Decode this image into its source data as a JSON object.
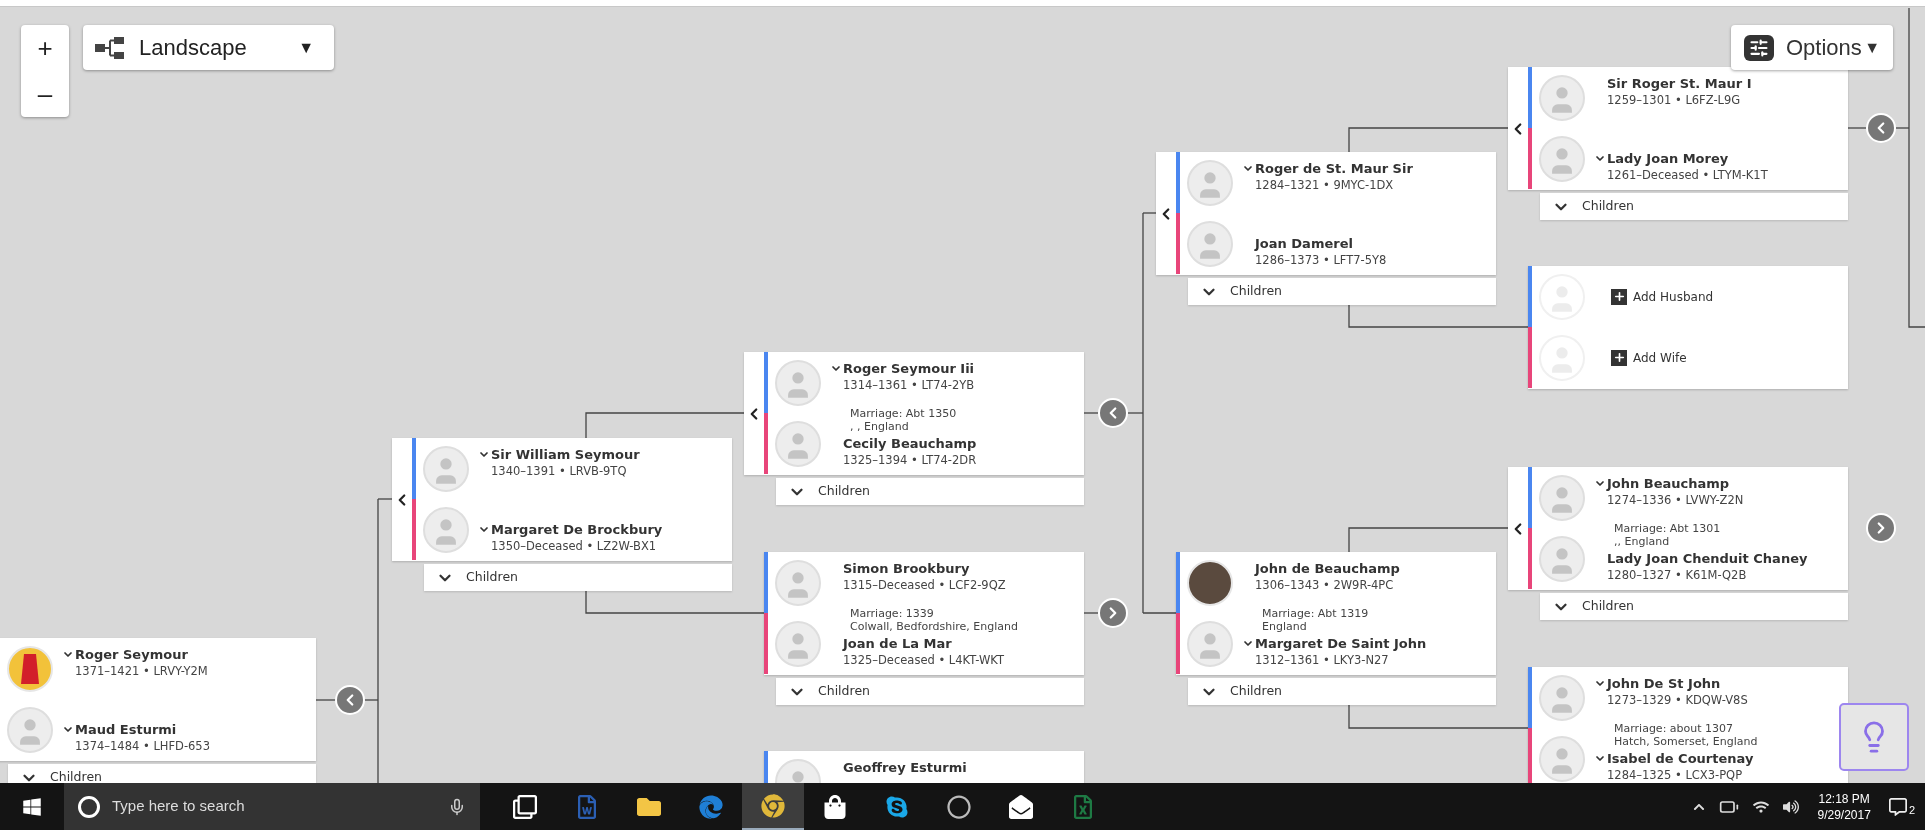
{
  "toolbar": {
    "zoom_in": "+",
    "zoom_out": "–",
    "view": {
      "label": "Landscape",
      "caret": "▼"
    },
    "options": {
      "label": "Options",
      "caret": "▼"
    }
  },
  "families": [
    {
      "parents_toggle": false,
      "husband": {
        "kind": "person",
        "name": "Roger Seymour",
        "vitals": "1371–1421 • LRVY-Y2M",
        "avatar": {
          "kind": "crest"
        },
        "expandable": true
      },
      "wife": {
        "kind": "person",
        "name": "Maud Esturmi",
        "vitals": "1374–1484 • LHFD-653",
        "avatar": {
          "kind": "silhouette"
        },
        "expandable": true
      },
      "children": "Children"
    },
    {
      "parents_toggle": true,
      "husband": {
        "kind": "person",
        "name": "Sir William Seymour",
        "vitals": "1340–1391 • LRVB-9TQ",
        "avatar": {
          "kind": "silhouette"
        },
        "expandable": true
      },
      "wife": {
        "kind": "person",
        "name": "Margaret De Brockbury",
        "vitals": "1350–Deceased • LZ2W-BX1",
        "avatar": {
          "kind": "silhouette"
        },
        "expandable": true
      },
      "children": "Children"
    },
    {
      "parents_toggle": true,
      "husband": {
        "kind": "person",
        "name": "Roger Seymour Iii",
        "vitals": "1314–1361 • LT74-2YB",
        "avatar": {
          "kind": "silhouette"
        },
        "expandable": true
      },
      "wife": {
        "kind": "person",
        "name": "Cecily Beauchamp",
        "vitals": "1325–1394 • LT74-2DR",
        "avatar": {
          "kind": "silhouette"
        },
        "expandable": false
      },
      "marriage": {
        "date": "Marriage: Abt 1350",
        "place": ", , England"
      },
      "children": "Children"
    },
    {
      "parents_toggle": false,
      "husband": {
        "kind": "person",
        "name": "Simon Brookbury",
        "vitals": "1315–Deceased • LCF2-9QZ",
        "avatar": {
          "kind": "silhouette"
        },
        "expandable": false
      },
      "wife": {
        "kind": "person",
        "name": "Joan de La Mar",
        "vitals": "1325–Deceased • L4KT-WKT",
        "avatar": {
          "kind": "silhouette"
        },
        "expandable": false
      },
      "marriage": {
        "date": "Marriage: 1339",
        "place": "Colwall, Bedfordshire, England"
      },
      "children": "Children"
    },
    {
      "parents_toggle": false,
      "husband": {
        "kind": "person",
        "name": "Geoffrey Esturmi",
        "avatar": {
          "kind": "silhouette"
        },
        "expandable": false
      }
    },
    {
      "parents_toggle": true,
      "husband": {
        "kind": "person",
        "name": "Roger de St. Maur Sir",
        "vitals": "1284–1321 • 9MYC-1DX",
        "avatar": {
          "kind": "silhouette"
        },
        "expandable": true
      },
      "wife": {
        "kind": "person",
        "name": "Joan Damerel",
        "vitals": "1286–1373 • LFT7-5Y8",
        "avatar": {
          "kind": "silhouette"
        },
        "expandable": false
      },
      "children": "Children"
    },
    {
      "parents_toggle": false,
      "husband": {
        "kind": "person",
        "name": "John de Beauchamp",
        "vitals": "1306–1343 • 2W9R-4PC",
        "avatar": {
          "kind": "photo"
        },
        "expandable": false
      },
      "wife": {
        "kind": "person",
        "name": "Margaret De Saint John",
        "vitals": "1312–1361 • LKY3-N27",
        "avatar": {
          "kind": "silhouette"
        },
        "expandable": true
      },
      "marriage": {
        "date": "Marriage: Abt 1319",
        "place": "England"
      },
      "children": "Children"
    },
    {
      "parents_toggle": true,
      "husband": {
        "kind": "person",
        "name": "Sir Roger St. Maur I",
        "vitals": "1259–1301 • L6FZ-L9G",
        "avatar": {
          "kind": "silhouette"
        },
        "expandable": false
      },
      "wife": {
        "kind": "person",
        "name": "Lady Joan Morey",
        "vitals": "1261–Deceased • LTYM-K1T",
        "avatar": {
          "kind": "silhouette"
        },
        "expandable": true
      },
      "children": "Children"
    },
    {
      "parents_toggle": false,
      "husband": {
        "kind": "add",
        "label": "Add Husband"
      },
      "wife": {
        "kind": "add",
        "label": "Add Wife"
      }
    },
    {
      "parents_toggle": true,
      "husband": {
        "kind": "person",
        "name": "John Beauchamp",
        "vitals": "1274–1336 • LVWY-Z2N",
        "avatar": {
          "kind": "silhouette"
        },
        "expandable": true
      },
      "wife": {
        "kind": "person",
        "name": "Lady Joan Chenduit Chaney",
        "vitals": "1280–1327 • K61M-Q2B",
        "avatar": {
          "kind": "silhouette"
        },
        "expandable": false
      },
      "marriage": {
        "date": "Marriage: Abt 1301",
        "place": ",, England"
      },
      "children": "Children"
    },
    {
      "parents_toggle": false,
      "husband": {
        "kind": "person",
        "name": "John De St John",
        "vitals": "1273–1329 • KDQW-V8S",
        "avatar": {
          "kind": "silhouette"
        },
        "expandable": true
      },
      "wife": {
        "kind": "person",
        "name": "Isabel de Courtenay",
        "vitals": "1284–1325 • LCX3-PQP",
        "avatar": {
          "kind": "silhouette"
        },
        "expandable": true
      },
      "marriage": {
        "date": "Marriage: about 1307",
        "place": "Hatch, Somerset, England"
      }
    }
  ],
  "nav_buttons": [
    {
      "kind": "left"
    },
    {
      "kind": "left"
    },
    {
      "kind": "right"
    },
    {
      "kind": "left"
    },
    {
      "kind": "right"
    }
  ],
  "taskbar": {
    "search_placeholder": "Type here to search",
    "apps": [
      {
        "kind": "task-view",
        "active": false
      },
      {
        "kind": "word",
        "active": false
      },
      {
        "kind": "explorer",
        "active": false
      },
      {
        "kind": "edge",
        "active": false
      },
      {
        "kind": "chrome",
        "active": true
      },
      {
        "kind": "store",
        "active": false
      },
      {
        "kind": "skype",
        "active": false
      },
      {
        "kind": "media",
        "active": false
      },
      {
        "kind": "mail",
        "active": false
      },
      {
        "kind": "excel",
        "active": false
      }
    ],
    "time": "12:18 PM",
    "date": "9/29/2017",
    "notifications": "2"
  }
}
